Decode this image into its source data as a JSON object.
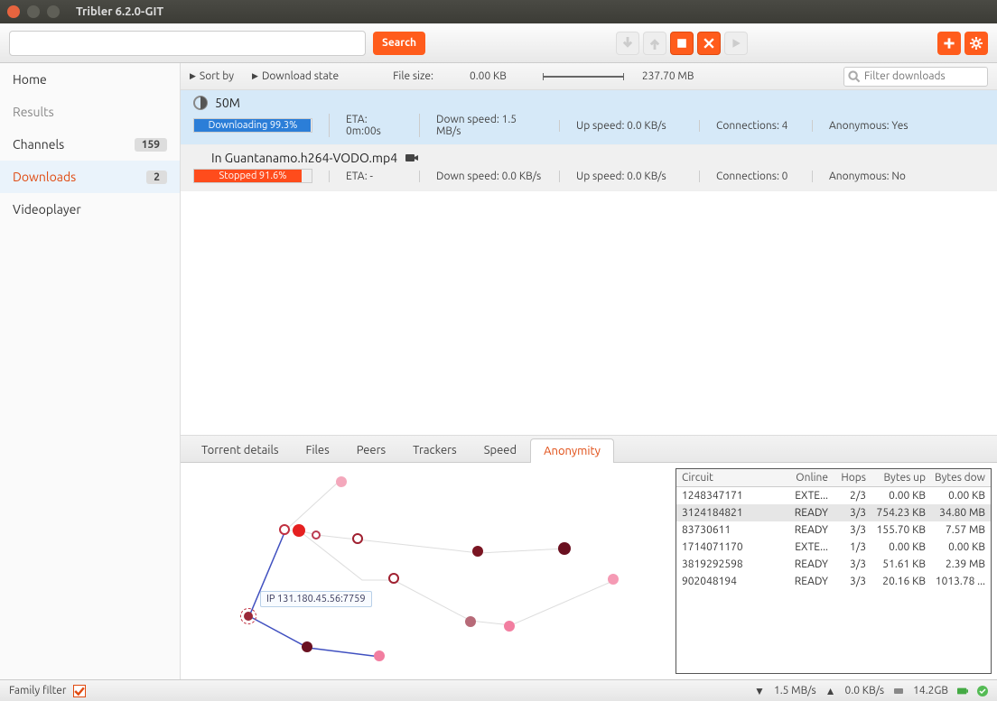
{
  "window": {
    "title": "Tribler 6.2.0-GIT"
  },
  "toolbar": {
    "search_btn": "Search"
  },
  "sidebar": {
    "items": [
      {
        "label": "Home",
        "badge": ""
      },
      {
        "label": "Results",
        "badge": ""
      },
      {
        "label": "Channels",
        "badge": "159"
      },
      {
        "label": "Downloads",
        "badge": "2"
      },
      {
        "label": "Videoplayer",
        "badge": ""
      }
    ]
  },
  "sortbar": {
    "sort_by": "Sort by",
    "dl_state": "Download state",
    "filesize": "File size:",
    "min": "0.00 KB",
    "max": "237.70 MB",
    "filter_ph": "Filter downloads"
  },
  "downloads": [
    {
      "name": "50M",
      "status_text": "Downloading 99.3%",
      "eta": "ETA: 0m:00s",
      "down": "Down speed: 1.5 MB/s",
      "up": "Up speed: 0.0 KB/s",
      "conn": "Connections: 4",
      "anon": "Anonymous: Yes"
    },
    {
      "name": "In Guantanamo.h264-VODO.mp4",
      "status_text": "Stopped 91.6%",
      "eta": "ETA: -",
      "down": "Down speed: 0.0 KB/s",
      "up": "Up speed: 0.0 KB/s",
      "conn": "Connections: 0",
      "anon": "Anonymous: No"
    }
  ],
  "tabs": [
    "Torrent details",
    "Files",
    "Peers",
    "Trackers",
    "Speed",
    "Anonymity"
  ],
  "graph": {
    "tooltip": "IP 131.180.45.56:7759"
  },
  "circuits": {
    "headers": [
      "Circuit",
      "Online",
      "Hops",
      "Bytes up",
      "Bytes dow"
    ],
    "rows": [
      [
        "1248347171",
        "EXTE...",
        "2/3",
        "0.00 KB",
        "0.00 KB"
      ],
      [
        "3124184821",
        "READY",
        "3/3",
        "754.23 KB",
        "34.80 MB"
      ],
      [
        "83730611",
        "READY",
        "3/3",
        "155.70 KB",
        "7.57 MB"
      ],
      [
        "1714071170",
        "EXTE...",
        "1/3",
        "0.00 KB",
        "0.00 KB"
      ],
      [
        "3819292598",
        "READY",
        "3/3",
        "51.61 KB",
        "2.39 MB"
      ],
      [
        "902048194",
        "READY",
        "3/3",
        "20.16 KB",
        "1013.78 ..."
      ]
    ]
  },
  "statusbar": {
    "family_filter": "Family filter",
    "down": "1.5 MB/s",
    "up": "0.0 KB/s",
    "disk": "14.2GB"
  }
}
